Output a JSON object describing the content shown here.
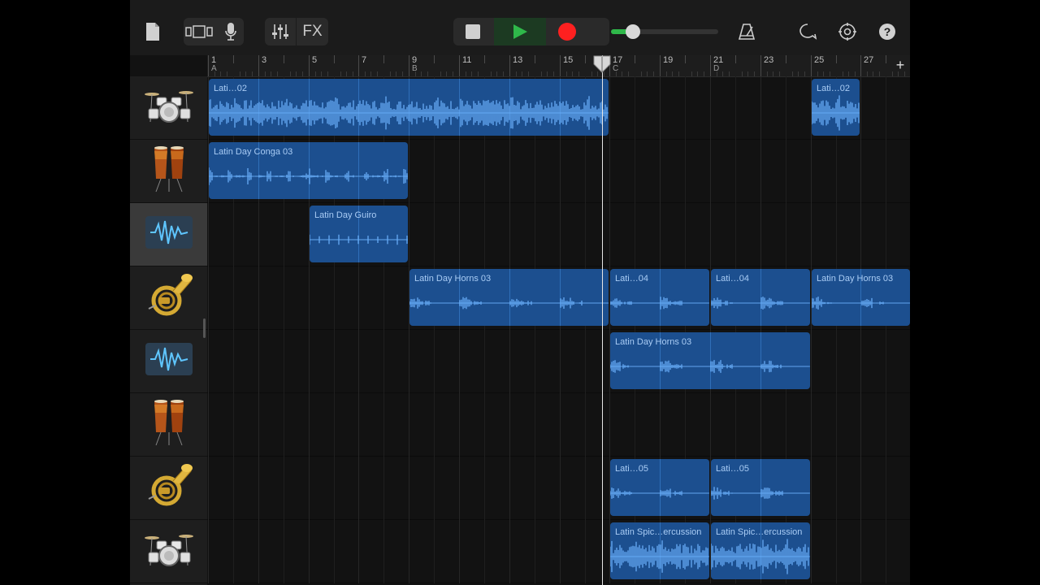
{
  "toolbar": {
    "buttons": [
      {
        "name": "my-songs-icon"
      },
      {
        "name": "view-toggle-icon"
      },
      {
        "name": "microphone-icon"
      },
      {
        "name": "mixer-icon"
      },
      {
        "name": "fx-button",
        "label": "FX"
      },
      {
        "name": "stop-icon"
      },
      {
        "name": "play-icon"
      },
      {
        "name": "record-icon"
      },
      {
        "name": "metronome-icon"
      },
      {
        "name": "loop-browser-icon"
      },
      {
        "name": "settings-icon"
      },
      {
        "name": "help-icon"
      }
    ],
    "master_volume": 0.2
  },
  "ruler": {
    "bar_numbers": [
      "1",
      "3",
      "5",
      "7",
      "9",
      "11",
      "13",
      "15",
      "17",
      "19",
      "21",
      "23",
      "25",
      "27"
    ],
    "section_markers": [
      "A",
      "B",
      "C",
      "D"
    ],
    "add_section_label": "+"
  },
  "colors": {
    "region_fill": "#1c4f8f",
    "region_label": "#a9ccf5",
    "waveform": "#6db3ff",
    "play_green": "#2fb84a",
    "record_red": "#ff2020"
  },
  "tracks": [
    {
      "instrument": "drum-kit-icon",
      "selected": false,
      "regions": [
        {
          "label": "Lati…02",
          "start": 1,
          "end": 17,
          "style": "dense"
        },
        {
          "label": "Lati…02",
          "start": 25,
          "end": 27,
          "style": "dense"
        }
      ]
    },
    {
      "instrument": "conga-icon",
      "selected": false,
      "regions": [
        {
          "label": "Latin Day Conga 03",
          "start": 1,
          "end": 9,
          "style": "sparse"
        }
      ]
    },
    {
      "instrument": "audio-waveform-icon",
      "selected": true,
      "regions": [
        {
          "label": "Latin Day Guiro",
          "start": 5,
          "end": 9,
          "style": "ticks"
        }
      ]
    },
    {
      "instrument": "french-horn-icon",
      "selected": false,
      "regions": [
        {
          "label": "Latin Day Horns 03",
          "start": 9,
          "end": 17,
          "style": "horns"
        },
        {
          "label": "Lati…04",
          "start": 17,
          "end": 21,
          "style": "horns"
        },
        {
          "label": "Lati…04",
          "start": 21,
          "end": 25,
          "style": "horns"
        },
        {
          "label": "Latin Day Horns 03",
          "start": 25,
          "end": 29,
          "style": "horns"
        }
      ]
    },
    {
      "instrument": "audio-waveform-icon",
      "selected": false,
      "regions": [
        {
          "label": "Latin Day Horns 03",
          "start": 17,
          "end": 25,
          "style": "horns"
        }
      ]
    },
    {
      "instrument": "conga-icon",
      "selected": false,
      "regions": []
    },
    {
      "instrument": "french-horn-icon",
      "selected": false,
      "regions": [
        {
          "label": "Lati…05",
          "start": 17,
          "end": 21,
          "style": "horns"
        },
        {
          "label": "Lati…05",
          "start": 21,
          "end": 25,
          "style": "horns"
        }
      ]
    },
    {
      "instrument": "drum-kit-icon",
      "selected": false,
      "regions": [
        {
          "label": "Latin Spic…ercussion",
          "start": 17,
          "end": 21,
          "style": "dense"
        },
        {
          "label": "Latin Spic…ercussion",
          "start": 21,
          "end": 25,
          "style": "dense"
        }
      ]
    }
  ],
  "playhead_bar": 17
}
